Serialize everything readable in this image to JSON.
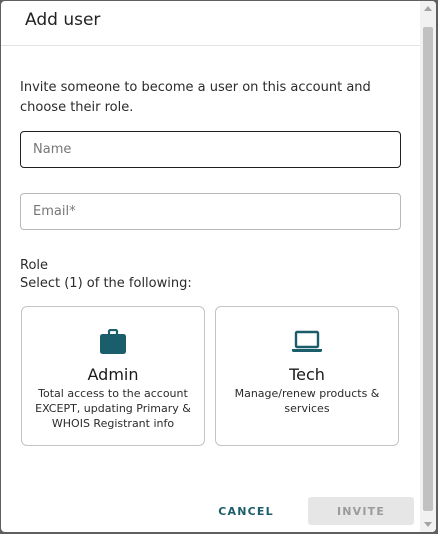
{
  "dialog": {
    "title": "Add user",
    "intro": "Invite someone to become a user on this account and choose their role."
  },
  "fields": {
    "name_placeholder": "Name",
    "name_value": "",
    "email_placeholder": "Email*",
    "email_value": ""
  },
  "role": {
    "heading": "Role",
    "instruction": "Select (1) of the following:",
    "options": [
      {
        "name": "Admin",
        "description": "Total access to the account EXCEPT, updating Primary & WHOIS Registrant info",
        "icon": "briefcase-icon"
      },
      {
        "name": "Tech",
        "description": "Manage/renew products & services",
        "icon": "laptop-icon"
      }
    ]
  },
  "actions": {
    "cancel_label": "CANCEL",
    "invite_label": "INVITE",
    "invite_enabled": false
  },
  "colors": {
    "icon": "#1b5e6b",
    "cancel_text": "#1a5e6a",
    "invite_bg_disabled": "#e6e6e6",
    "invite_text_disabled": "#9b9b9b",
    "backdrop": "#5f5f5f"
  }
}
